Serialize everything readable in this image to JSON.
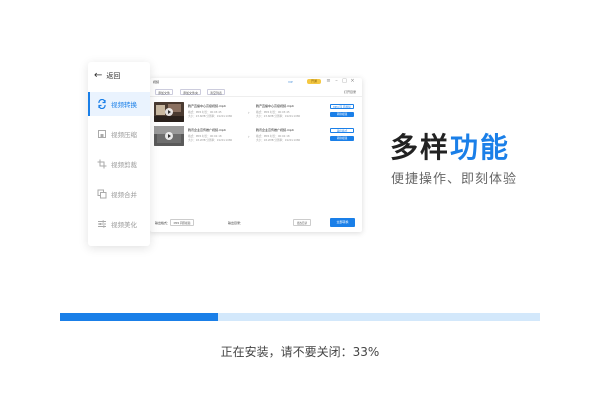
{
  "sidebar": {
    "back_label": "返回",
    "items": [
      {
        "label": "视频转换",
        "icon": "convert-icon",
        "active": true
      },
      {
        "label": "视频压缩",
        "icon": "compress-icon",
        "active": false
      },
      {
        "label": "视频剪裁",
        "icon": "crop-icon",
        "active": false
      },
      {
        "label": "视频合并",
        "icon": "merge-icon",
        "active": false
      },
      {
        "label": "视频美化",
        "icon": "beautify-icon",
        "active": false
      }
    ]
  },
  "preview": {
    "title": "视频",
    "vip": "VIP",
    "open_label": "开通",
    "toolbar": {
      "add_file": "添加文件",
      "add_folder": "添加文件夹",
      "clear_list": "清空列表",
      "open_folder": "打开目录"
    },
    "files": [
      {
        "name": "腾产直播中心高级视频.mp4",
        "meta1": "格式：MP4    时长：00:03:45",
        "meta2": "大小：23.6MB  分辨率：1920×1080",
        "out_name": "腾产直播中心高级视频.mp4",
        "out_meta1": "格式：MP4    时长：00:03:45",
        "out_meta2": "大小：23.6MB  分辨率：1920×1080",
        "fmt_label": "MP4 同 原视频",
        "action_label": "转换视频"
      },
      {
        "name": "腾讯企业宣传推广视频.mp4",
        "meta1": "格式：MP4    时长：00:02:18",
        "meta2": "大小：18.2MB  分辨率：1920×1080",
        "out_name": "腾讯企业宣传推广视频.mp4",
        "out_meta1": "格式：MP4    时长：00:02:18",
        "out_meta2": "大小：18.2MB  分辨率：1920×1080",
        "fmt_label": "输出格式",
        "action_label": "转换视频"
      }
    ],
    "footer": {
      "output_label": "输出格式：",
      "output_value": "MP4 同原视频",
      "dir_label": "输出目录：",
      "dir_value": "更改目录",
      "start_label": "全部转换"
    }
  },
  "headline": {
    "part1": "多样",
    "part2": "功能"
  },
  "subline": "便捷操作、即刻体验",
  "progress": {
    "percent": 33,
    "status": "正在安装，请不要关闭：33%"
  },
  "colors": {
    "accent": "#1a7fe8",
    "track": "#d3e8fb",
    "active_bg": "#eaf3fe"
  }
}
